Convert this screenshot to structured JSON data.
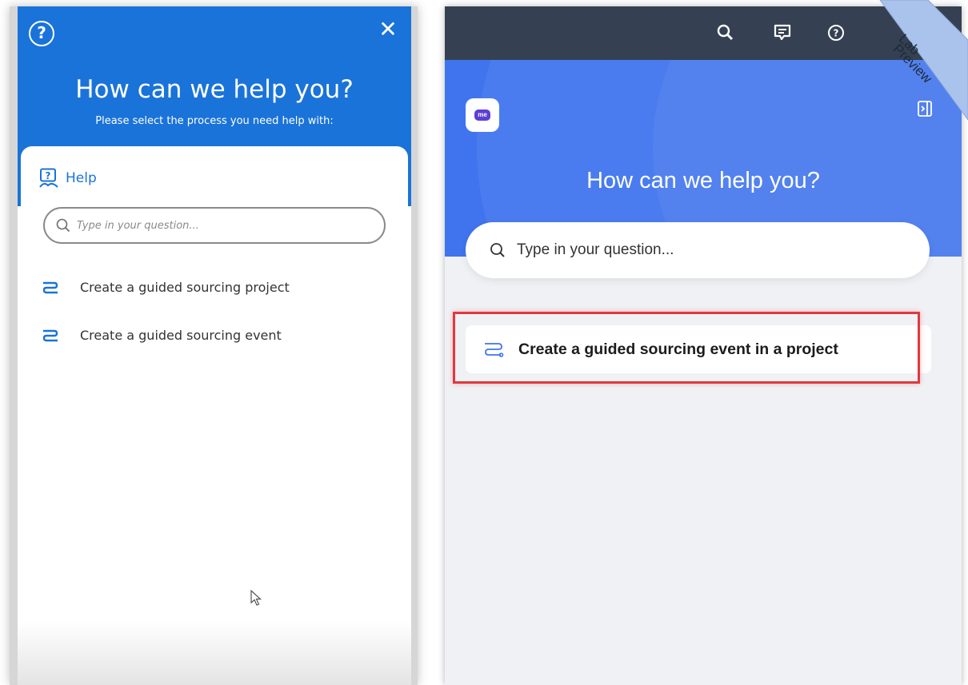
{
  "left_panel": {
    "header": {
      "title": "How can we help you?",
      "subtitle": "Please select the process you need help with:",
      "close_glyph": "✕",
      "help_glyph": "?"
    },
    "help_label": "Help",
    "search": {
      "placeholder": "Type in your question..."
    },
    "items": [
      {
        "label": "Create a guided sourcing project",
        "icon": "flow-steps-icon"
      },
      {
        "label": "Create a guided sourcing event",
        "icon": "flow-steps-icon"
      }
    ]
  },
  "right_panel": {
    "topbar": {
      "icons": [
        "search-icon",
        "feedback-icon",
        "help-icon"
      ]
    },
    "logo_text": "me",
    "title": "How can we help you?",
    "search": {
      "placeholder": "Type in your question..."
    },
    "items": [
      {
        "label": "Create a guided sourcing event in a project",
        "icon": "flow-steps-icon",
        "highlighted": true
      }
    ],
    "ribbon": {
      "line1": "Lab",
      "line2": "Preview"
    }
  },
  "colors": {
    "left_header": "#1a73d9",
    "right_topbar": "#354152",
    "right_hero": "#3f74ee",
    "highlight": "#e0383e",
    "ribbon": "#a9c3ec"
  }
}
